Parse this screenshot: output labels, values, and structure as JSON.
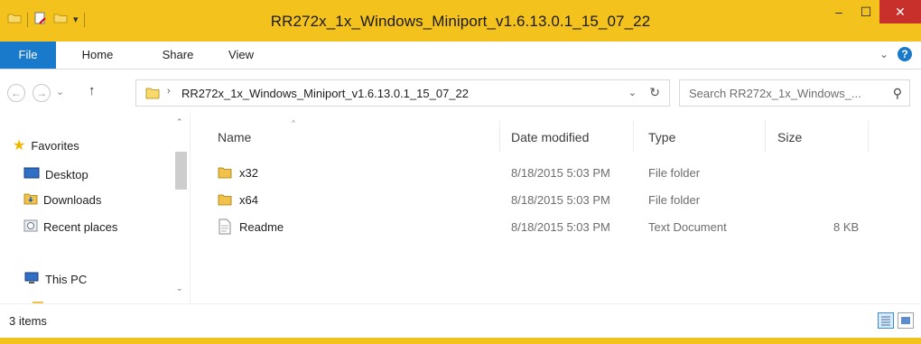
{
  "window": {
    "title": "RR272x_1x_Windows_Miniport_v1.6.13.0.1_15_07_22",
    "accent_color": "#f3c21d",
    "minimize": "–",
    "maximize": "☐",
    "close": "✕"
  },
  "ribbon": {
    "tabs": [
      "File",
      "Home",
      "Share",
      "View"
    ],
    "expand_glyph": "⌄",
    "help_glyph": "?"
  },
  "address": {
    "back": "←",
    "forward": "→",
    "recent": "⌄",
    "up": "↑",
    "breadcrumb_caret": "›",
    "path": "RR272x_1x_Windows_Miniport_v1.6.13.0.1_15_07_22",
    "dropdown": "⌄",
    "refresh": "↻"
  },
  "search": {
    "placeholder": "Search RR272x_1x_Windows_...",
    "icon": "⚲"
  },
  "nav_pane": {
    "items": [
      {
        "label": "Favorites",
        "icon": "star-icon"
      },
      {
        "label": "Desktop",
        "icon": "desktop-icon"
      },
      {
        "label": "Downloads",
        "icon": "downloads-folder-icon"
      },
      {
        "label": "Recent places",
        "icon": "recent-places-icon"
      },
      {
        "label": "This PC",
        "icon": "computer-icon"
      }
    ],
    "scroll_up": "⌃",
    "scroll_down": "⌄"
  },
  "file_list": {
    "columns": [
      "Name",
      "Date modified",
      "Type",
      "Size"
    ],
    "sort_glyph": "^",
    "rows": [
      {
        "name": "x32",
        "date": "8/18/2015 5:03 PM",
        "type": "File folder",
        "size": "",
        "icon": "folder-icon"
      },
      {
        "name": "x64",
        "date": "8/18/2015 5:03 PM",
        "type": "File folder",
        "size": "",
        "icon": "folder-icon"
      },
      {
        "name": "Readme",
        "date": "8/18/2015 5:03 PM",
        "type": "Text Document",
        "size": "8 KB",
        "icon": "text-document-icon"
      }
    ]
  },
  "status": {
    "count": "3 items"
  }
}
